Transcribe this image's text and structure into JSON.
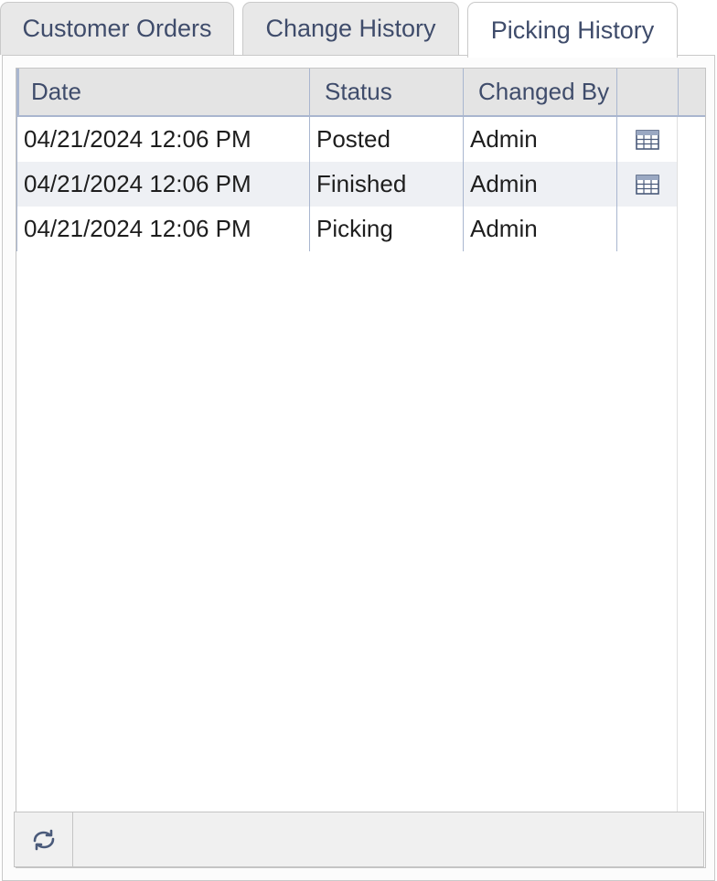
{
  "tabs": [
    {
      "label": "Customer Orders",
      "active": false
    },
    {
      "label": "Change History",
      "active": false
    },
    {
      "label": "Picking History",
      "active": true
    }
  ],
  "grid": {
    "columns": [
      "Date",
      "Status",
      "Changed By",
      ""
    ],
    "rows": [
      {
        "date": "04/21/2024 12:06 PM",
        "status": "Posted",
        "changed_by": "Admin",
        "icon": "table-icon"
      },
      {
        "date": "04/21/2024 12:06 PM",
        "status": "Finished",
        "changed_by": "Admin",
        "icon": "table-icon"
      },
      {
        "date": "04/21/2024 12:06 PM",
        "status": "Picking",
        "changed_by": "Admin",
        "icon": ""
      }
    ]
  },
  "footer": {
    "refresh_icon": "refresh-icon"
  },
  "colors": {
    "tab_text": "#3f4c6b",
    "header_bg": "#e4e4e4",
    "grid_lines": "#a9b6cf",
    "alt_row": "#eef0f4",
    "icon": "#4a5a7a"
  }
}
